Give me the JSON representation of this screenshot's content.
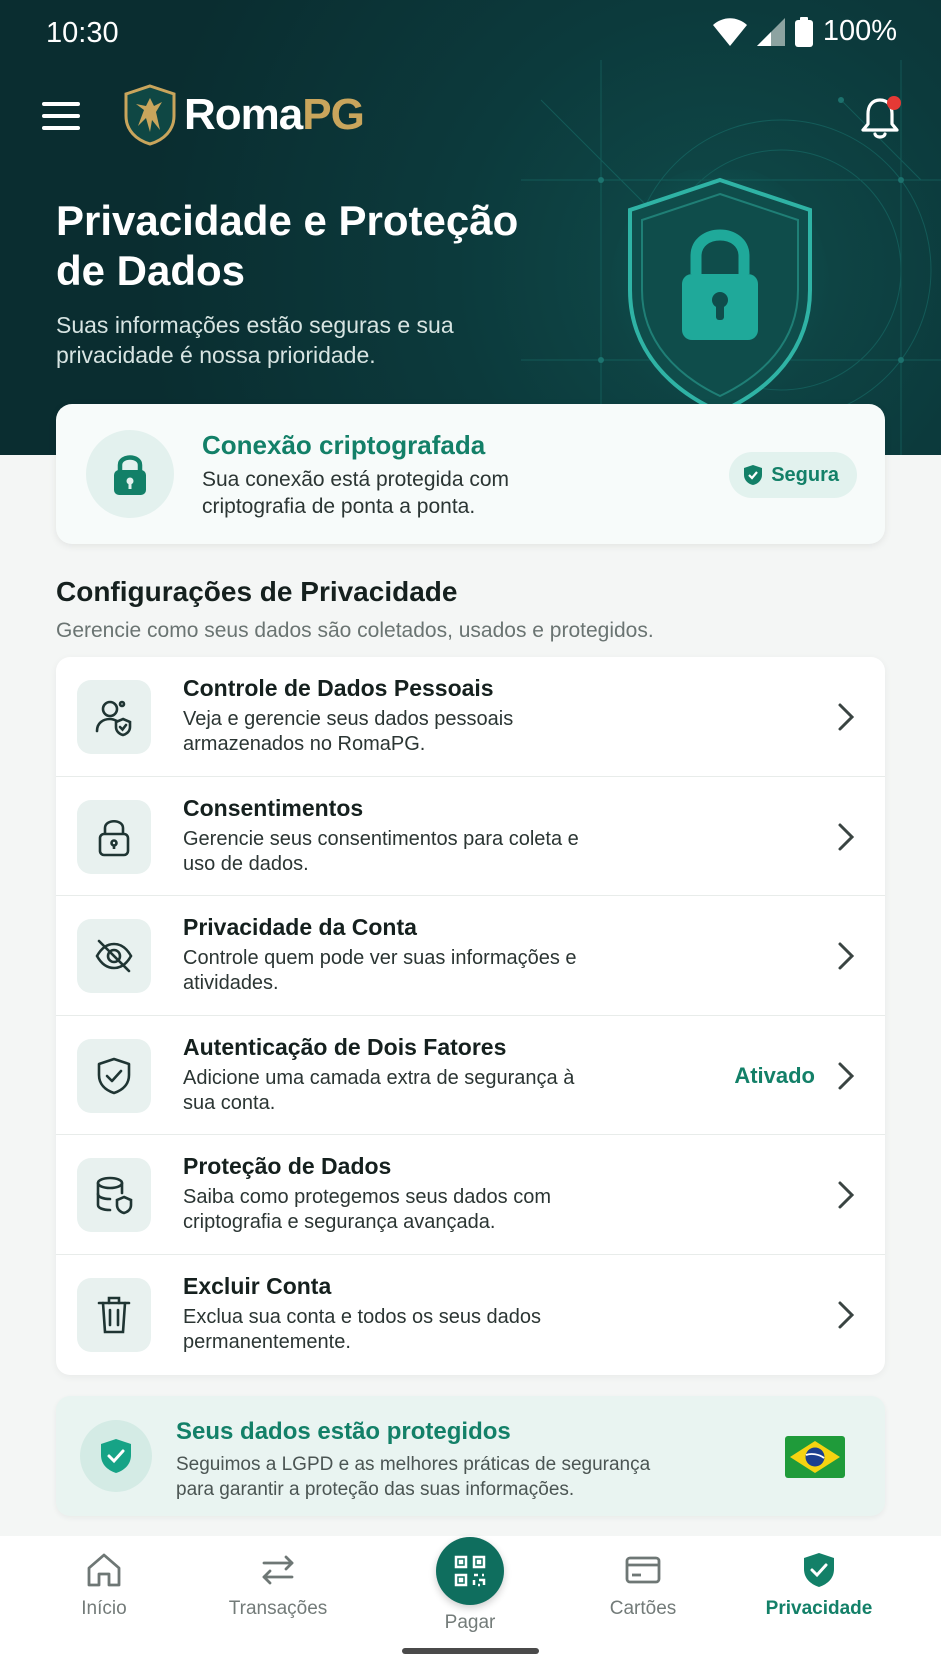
{
  "status_bar": {
    "time": "10:30",
    "battery": "100%"
  },
  "app": {
    "brand_part1": "Roma",
    "brand_part2": "PG"
  },
  "hero": {
    "title": "Privacidade e Proteção de Dados",
    "subtitle": "Suas informações estão seguras e sua privacidade é nossa prioridade."
  },
  "connection": {
    "title": "Conexão criptografada",
    "description": "Sua conexão está protegida com criptografia de ponta a ponta.",
    "badge": "Segura"
  },
  "privacy": {
    "title": "Configurações de Privacidade",
    "subtitle": "Gerencie como seus dados são coletados, usados e protegidos.",
    "items": [
      {
        "title": "Controle de Dados Pessoais",
        "description": "Veja e gerencie seus dados pessoais armazenados no RomaPG.",
        "icon": "user-shield-icon",
        "status": ""
      },
      {
        "title": "Consentimentos",
        "description": "Gerencie seus consentimentos para coleta e uso de dados.",
        "icon": "lock-icon",
        "status": ""
      },
      {
        "title": "Privacidade da Conta",
        "description": "Controle quem pode ver suas informações e atividades.",
        "icon": "eye-off-icon",
        "status": ""
      },
      {
        "title": "Autenticação de Dois Fatores",
        "description": "Adicione uma camada extra de segurança à sua conta.",
        "icon": "shield-check-icon",
        "status": "Ativado"
      },
      {
        "title": "Proteção de Dados",
        "description": "Saiba como protegemos seus dados com criptografia e segurança avançada.",
        "icon": "database-shield-icon",
        "status": ""
      },
      {
        "title": "Excluir Conta",
        "description": "Exclua sua conta e todos os seus dados permanentemente.",
        "icon": "trash-icon",
        "status": ""
      }
    ]
  },
  "protection_notice": {
    "title": "Seus dados estão protegidos",
    "description": "Seguimos a LGPD e as melhores práticas de segurança para garantir a proteção das suas informações."
  },
  "nav": {
    "items": [
      {
        "label": "Início",
        "icon": "home-icon"
      },
      {
        "label": "Transações",
        "icon": "transfer-icon"
      },
      {
        "label": "Pagar",
        "icon": "qr-code-icon"
      },
      {
        "label": "Cartões",
        "icon": "card-icon"
      },
      {
        "label": "Privacidade",
        "icon": "shield-check-icon"
      }
    ],
    "active": "Privacidade"
  },
  "colors": {
    "hero_bg": "#0a2d30",
    "accent": "#138068",
    "brand_gold": "#c9a55c",
    "notification": "#e53935"
  }
}
